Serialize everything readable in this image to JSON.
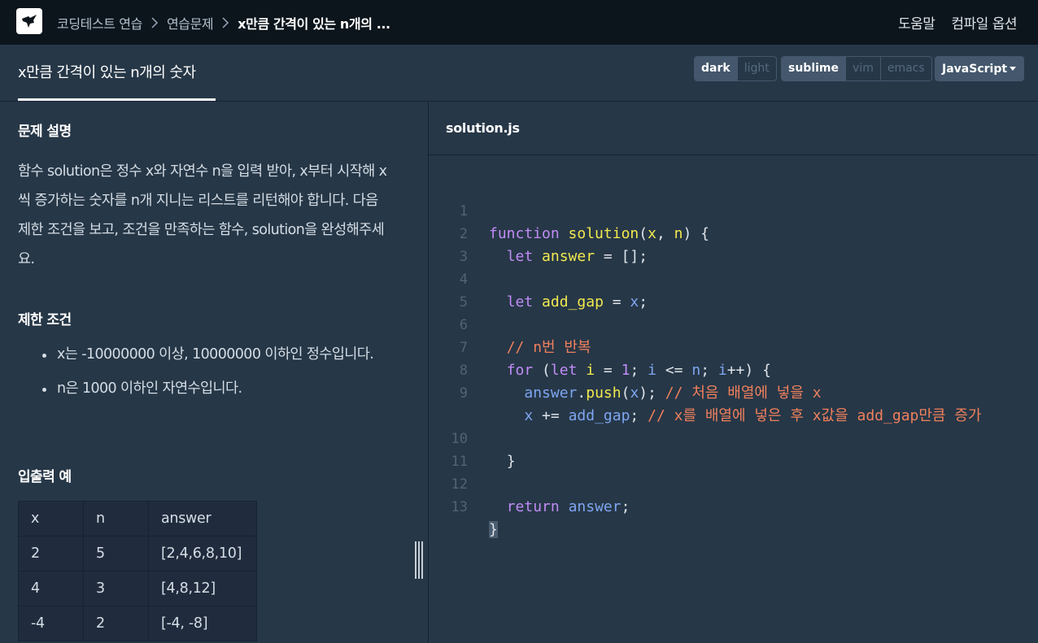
{
  "topnav": {
    "breadcrumb": [
      "코딩테스트 연습",
      "연습문제",
      "x만큼 간격이 있는 n개의 ..."
    ],
    "help": "도움말",
    "compile_options": "컴파일 옵션"
  },
  "challenge": {
    "title": "x만큼 간격이 있는 n개의 숫자",
    "theme_options": [
      "dark",
      "light"
    ],
    "theme_selected": "dark",
    "keymap_options": [
      "sublime",
      "vim",
      "emacs"
    ],
    "keymap_selected": "sublime",
    "language": "JavaScript"
  },
  "description": {
    "problem_heading": "문제 설명",
    "problem_text": "함수 solution은 정수 x와 자연수 n을 입력 받아, x부터 시작해 x씩 증가하는 숫자를 n개 지니는 리스트를 리턴해야 합니다. 다음 제한 조건을 보고, 조건을 만족하는 함수, solution을 완성해주세요.",
    "constraints_heading": "제한 조건",
    "constraints": [
      "x는 -10000000 이상, 10000000 이하인 정수입니다.",
      "n은 1000 이하인 자연수입니다."
    ],
    "io_heading": "입출력 예",
    "io_table": {
      "headers": [
        "x",
        "n",
        "answer"
      ],
      "rows": [
        [
          "2",
          "5",
          "[2,4,6,8,10]"
        ],
        [
          "4",
          "3",
          "[4,8,12]"
        ],
        [
          "-4",
          "2",
          "[-4, -8]"
        ]
      ]
    }
  },
  "editor": {
    "file_name": "solution.js",
    "line_numbers": [
      "1",
      "2",
      "3",
      "4",
      "5",
      "6",
      "7",
      "8",
      "9",
      "10",
      "11",
      "12",
      "13"
    ],
    "tokens": {
      "function": "function",
      "solution": "solution",
      "open_paren": "(",
      "x": "x",
      "comma": ", ",
      "n": "n",
      "close_brace_open": ") {",
      "let": "let",
      "answer": "answer",
      "eq_arr": " = [];",
      "add_gap": "add_gap",
      "eq": " = ",
      "semi": ";",
      "comment_loop": "// n번 반복",
      "for": "for",
      "lp": " (",
      "i": "i",
      "eq1": " = ",
      "one": "1",
      "semi_sp": "; ",
      "le": " <= ",
      "inc": "++",
      "close_open": ") {",
      "push": "push",
      "dot": ".",
      "rp_semi": ");",
      "comment_push": " // 처음 배열에 넣을 x",
      "plus_eq": " += ",
      "comment_gap": " // x를 배열에 넣은 후 x값을 add_gap만큼 증가",
      "close_brace": "}",
      "return": "return"
    }
  }
}
